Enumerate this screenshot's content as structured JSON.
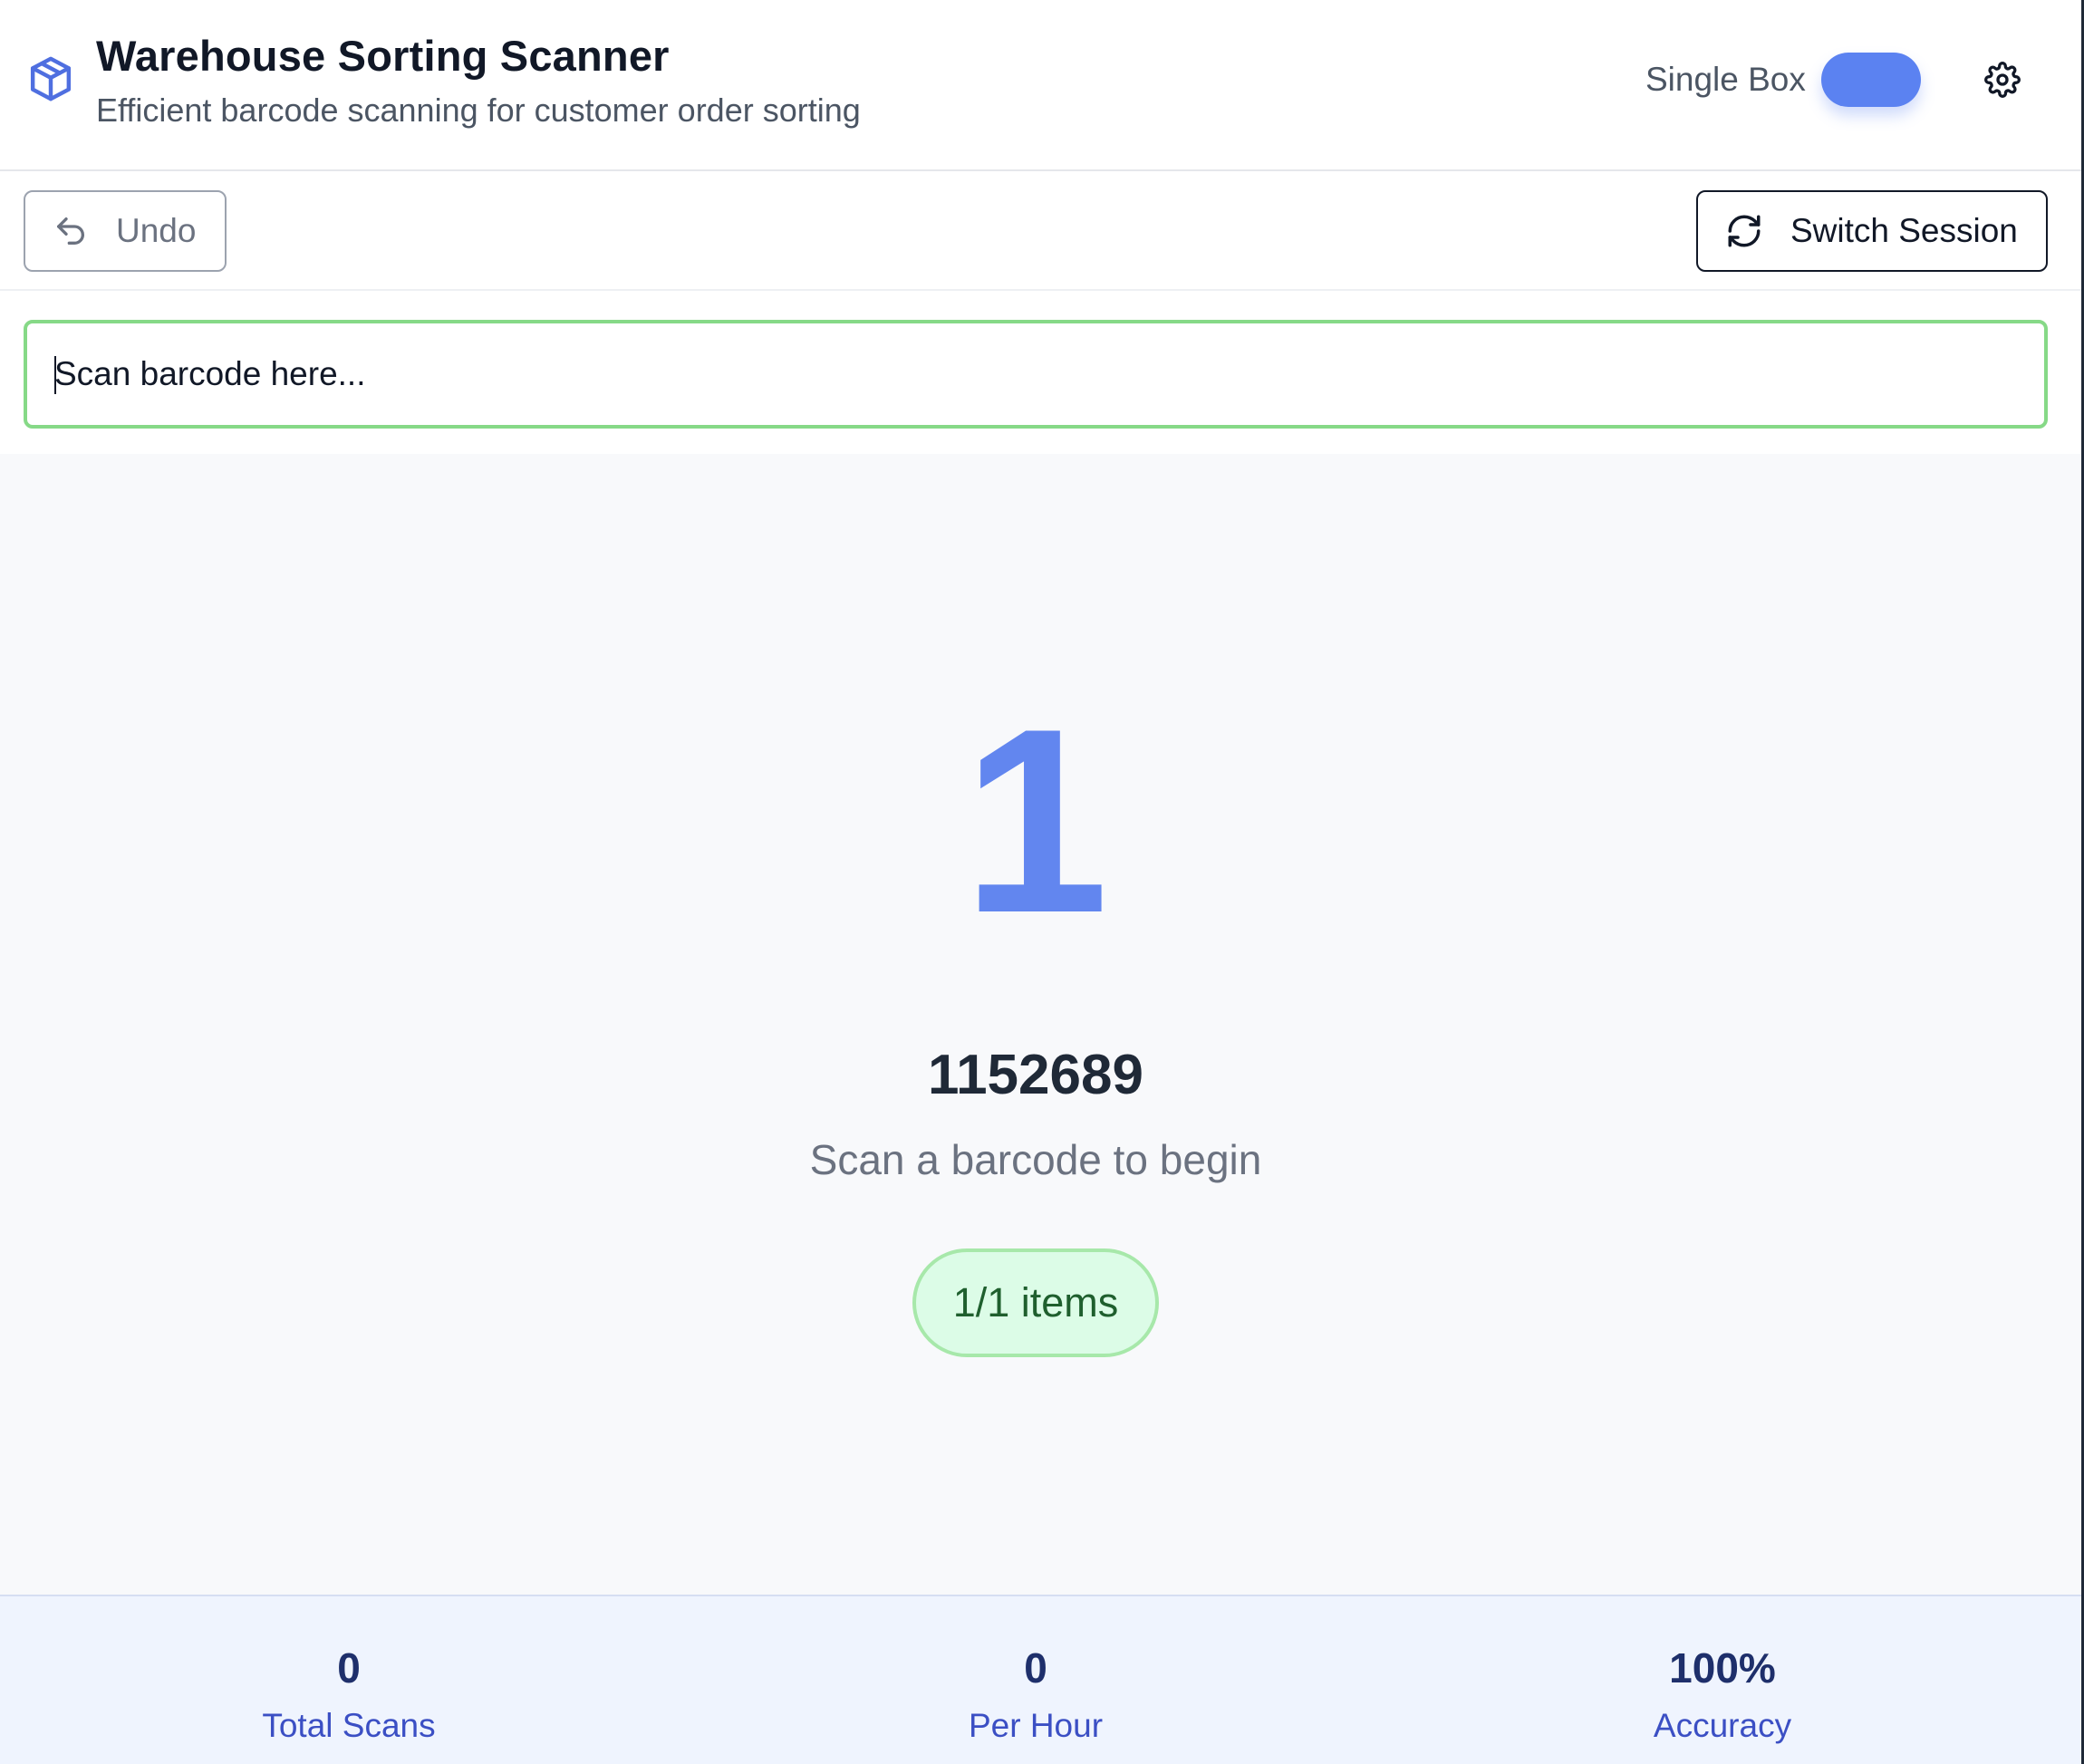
{
  "header": {
    "title": "Warehouse Sorting Scanner",
    "subtitle": "Efficient barcode scanning for customer order sorting",
    "mode_label": "Single Box",
    "mode_toggle_on": true,
    "icons": {
      "logo": "package-icon",
      "settings": "gear-icon"
    }
  },
  "toolbar": {
    "undo_label": "Undo",
    "switch_session_label": "Switch Session",
    "icons": {
      "undo": "undo-icon",
      "switch": "refresh-icon"
    }
  },
  "scan": {
    "placeholder": "Scan barcode here...",
    "value": ""
  },
  "main": {
    "box_number": "1",
    "order_id": "1152689",
    "prompt": "Scan a barcode to begin",
    "items_badge": "1/1 items"
  },
  "stats": [
    {
      "value": "0",
      "label": "Total Scans"
    },
    {
      "value": "0",
      "label": "Per Hour"
    },
    {
      "value": "100%",
      "label": "Accuracy"
    }
  ],
  "colors": {
    "accent": "#6286ef",
    "toggle": "#5b82f1",
    "input_border": "#86d987",
    "badge_bg": "#dcfce7",
    "badge_text": "#1f5f2e",
    "stats_bg": "#eff4fe"
  }
}
